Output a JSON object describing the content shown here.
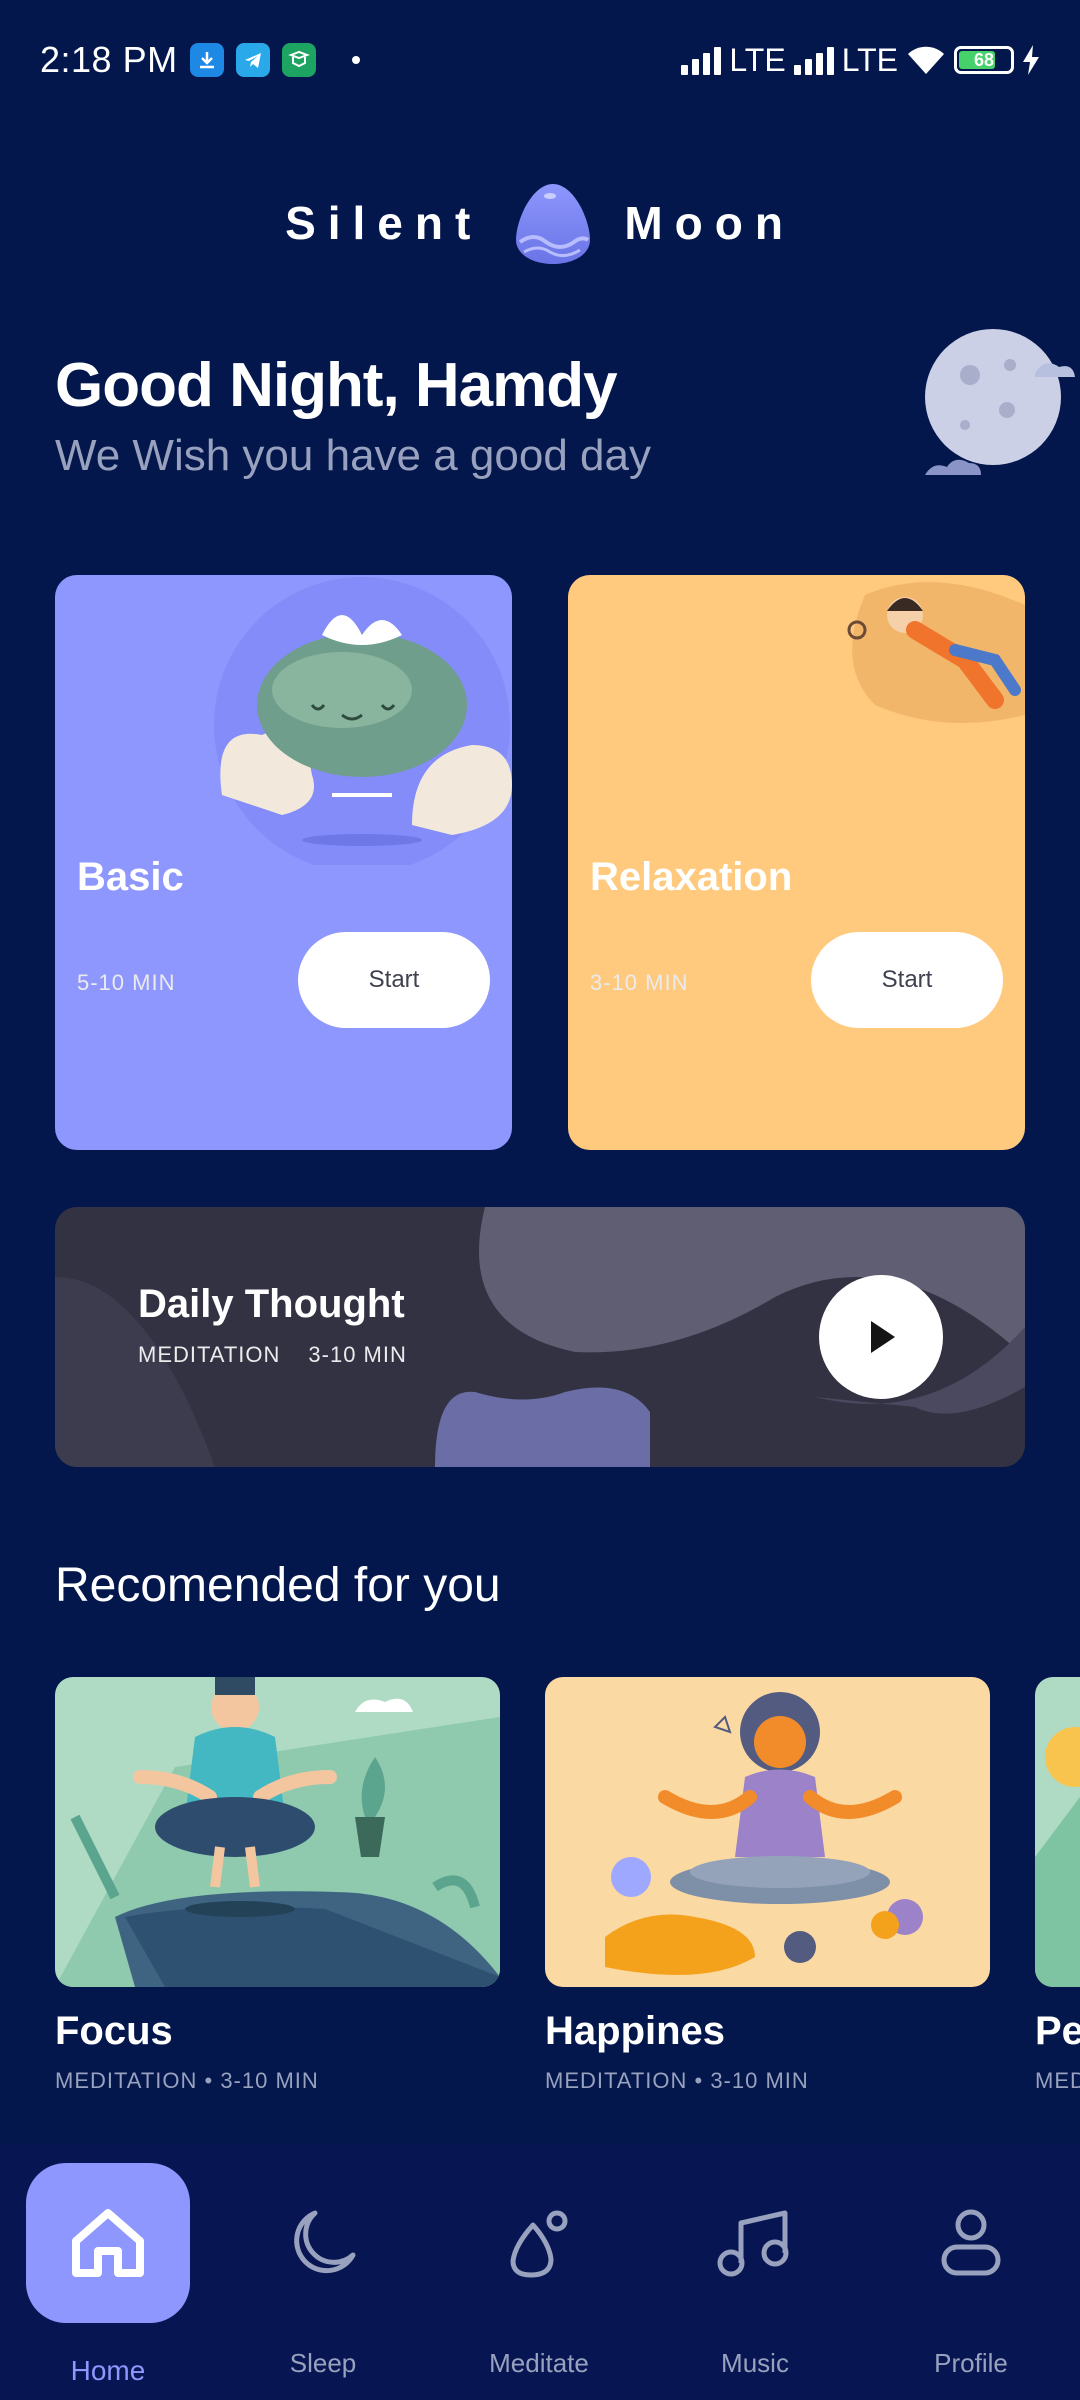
{
  "status_bar": {
    "time": "2:18 PM",
    "network1": "LTE",
    "network2": "LTE",
    "battery": "68",
    "icons": [
      "download-app-icon",
      "telegram-icon",
      "reader-app-icon",
      "signal-icon",
      "wifi-icon",
      "battery-icon",
      "charging-icon"
    ]
  },
  "logo": {
    "left": "Silent",
    "right": "Moon"
  },
  "greeting": {
    "title": "Good Night, Hamdy",
    "subtitle": "We Wish you have a good day"
  },
  "cards": [
    {
      "title": "Basic",
      "meta": "5-10 MIN",
      "button": "Start",
      "color": "#8E97FD"
    },
    {
      "title": "Relaxation",
      "meta": "3-10 MIN",
      "button": "Start",
      "color": "#FFC97E"
    }
  ],
  "daily": {
    "title": "Daily Thought",
    "type": "MEDITATION",
    "duration": "3-10 MIN"
  },
  "recommended": {
    "heading": "Recomended for you",
    "items": [
      {
        "title": "Focus",
        "meta": "MEDITATION • 3-10 MIN"
      },
      {
        "title": "Happines",
        "meta": "MEDITATION • 3-10 MIN"
      },
      {
        "title": "Pe",
        "meta": "MED"
      }
    ]
  },
  "nav": [
    {
      "label": "Home",
      "icon": "home-icon",
      "active": true
    },
    {
      "label": "Sleep",
      "icon": "moon-icon",
      "active": false
    },
    {
      "label": "Meditate",
      "icon": "meditate-icon",
      "active": false
    },
    {
      "label": "Music",
      "icon": "music-icon",
      "active": false
    },
    {
      "label": "Profile",
      "icon": "profile-icon",
      "active": false
    }
  ],
  "colors": {
    "background": "#03174C",
    "accent": "#8E97FD",
    "warm": "#FFC97E",
    "nav_bg": "#071652",
    "muted_text": "#98A1BD"
  }
}
